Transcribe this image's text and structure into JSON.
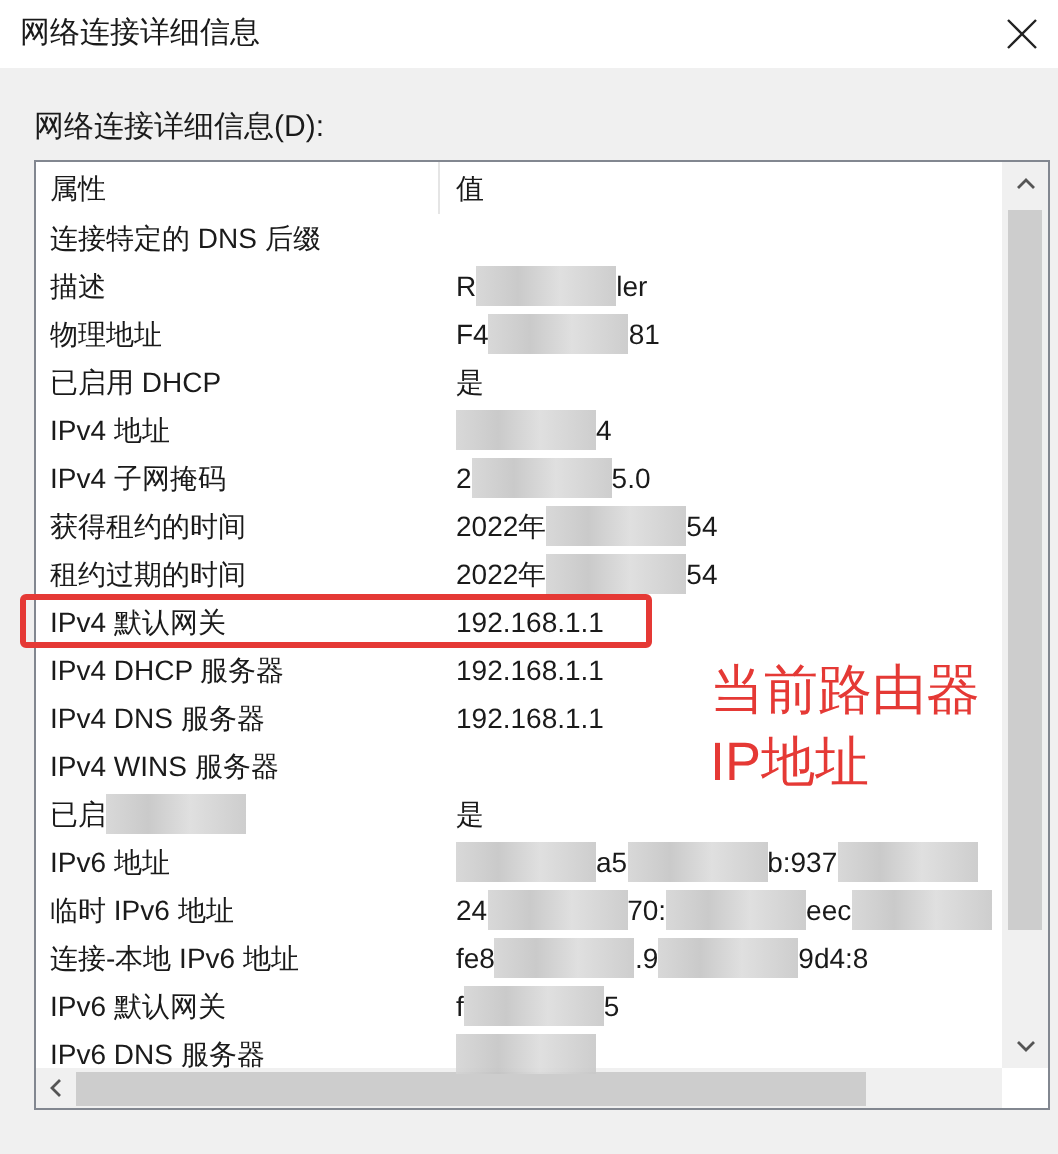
{
  "window": {
    "title": "网络连接详细信息"
  },
  "list_label": "网络连接详细信息(D):",
  "columns": [
    "属性",
    "值"
  ],
  "rows": [
    {
      "property": [
        {
          "kind": "text",
          "text": "连接特定的 DNS 后缀"
        }
      ],
      "value": [],
      "highlighted": false
    },
    {
      "property": [
        {
          "kind": "text",
          "text": "描述"
        }
      ],
      "value": [
        {
          "kind": "text",
          "text": "R"
        },
        {
          "kind": "blur"
        },
        {
          "kind": "text",
          "text": "ler"
        }
      ],
      "highlighted": false
    },
    {
      "property": [
        {
          "kind": "text",
          "text": "物理地址"
        }
      ],
      "value": [
        {
          "kind": "text",
          "text": "F4"
        },
        {
          "kind": "blur"
        },
        {
          "kind": "text",
          "text": "81"
        }
      ],
      "highlighted": false
    },
    {
      "property": [
        {
          "kind": "text",
          "text": "已启用 DHCP"
        }
      ],
      "value": [
        {
          "kind": "text",
          "text": "是"
        }
      ],
      "highlighted": false
    },
    {
      "property": [
        {
          "kind": "text",
          "text": "IPv4 地址"
        }
      ],
      "value": [
        {
          "kind": "blur"
        },
        {
          "kind": "text",
          "text": "4"
        }
      ],
      "highlighted": false
    },
    {
      "property": [
        {
          "kind": "text",
          "text": "IPv4 子网掩码"
        }
      ],
      "value": [
        {
          "kind": "text",
          "text": "2"
        },
        {
          "kind": "blur"
        },
        {
          "kind": "text",
          "text": "5.0"
        }
      ],
      "highlighted": false
    },
    {
      "property": [
        {
          "kind": "text",
          "text": "获得租约的时间"
        }
      ],
      "value": [
        {
          "kind": "text",
          "text": "2022年"
        },
        {
          "kind": "blur"
        },
        {
          "kind": "text",
          "text": "54"
        }
      ],
      "highlighted": false
    },
    {
      "property": [
        {
          "kind": "text",
          "text": "租约过期的时间"
        }
      ],
      "value": [
        {
          "kind": "text",
          "text": "2022年"
        },
        {
          "kind": "blur"
        },
        {
          "kind": "text",
          "text": "54"
        }
      ],
      "highlighted": false
    },
    {
      "property": [
        {
          "kind": "text",
          "text": "IPv4 默认网关"
        }
      ],
      "value": [
        {
          "kind": "text",
          "text": "192.168.1.1"
        }
      ],
      "highlighted": true
    },
    {
      "property": [
        {
          "kind": "text",
          "text": "IPv4 DHCP 服务器"
        }
      ],
      "value": [
        {
          "kind": "text",
          "text": "192.168.1.1"
        }
      ],
      "highlighted": false
    },
    {
      "property": [
        {
          "kind": "text",
          "text": "IPv4 DNS 服务器"
        }
      ],
      "value": [
        {
          "kind": "text",
          "text": "192.168.1.1"
        }
      ],
      "highlighted": false
    },
    {
      "property": [
        {
          "kind": "text",
          "text": "IPv4 WINS 服务器"
        }
      ],
      "value": [],
      "highlighted": false
    },
    {
      "property": [
        {
          "kind": "text",
          "text": "已启"
        },
        {
          "kind": "blur"
        }
      ],
      "value": [
        {
          "kind": "text",
          "text": "是"
        }
      ],
      "highlighted": false
    },
    {
      "property": [
        {
          "kind": "text",
          "text": "IPv6 地址"
        }
      ],
      "value": [
        {
          "kind": "blur"
        },
        {
          "kind": "text",
          "text": "a5"
        },
        {
          "kind": "blur"
        },
        {
          "kind": "text",
          "text": "b:937"
        },
        {
          "kind": "blur"
        }
      ],
      "highlighted": false
    },
    {
      "property": [
        {
          "kind": "text",
          "text": "临时 IPv6 地址"
        }
      ],
      "value": [
        {
          "kind": "text",
          "text": "24"
        },
        {
          "kind": "blur"
        },
        {
          "kind": "text",
          "text": "70:"
        },
        {
          "kind": "blur"
        },
        {
          "kind": "text",
          "text": "eec"
        },
        {
          "kind": "blur"
        }
      ],
      "highlighted": false
    },
    {
      "property": [
        {
          "kind": "text",
          "text": "连接-本地 IPv6 地址"
        }
      ],
      "value": [
        {
          "kind": "text",
          "text": "fe8"
        },
        {
          "kind": "blur"
        },
        {
          "kind": "text",
          "text": ".9"
        },
        {
          "kind": "blur"
        },
        {
          "kind": "text",
          "text": "9d4:8"
        }
      ],
      "highlighted": false
    },
    {
      "property": [
        {
          "kind": "text",
          "text": "IPv6 默认网关"
        }
      ],
      "value": [
        {
          "kind": "text",
          "text": "f"
        },
        {
          "kind": "blur"
        },
        {
          "kind": "text",
          "text": "5"
        }
      ],
      "highlighted": false
    },
    {
      "property": [
        {
          "kind": "text",
          "text": "IPv6 DNS 服务器"
        }
      ],
      "value": [
        {
          "kind": "blur"
        }
      ],
      "highlighted": false
    }
  ],
  "annotation": [
    "当前路由器",
    "IP地址"
  ]
}
